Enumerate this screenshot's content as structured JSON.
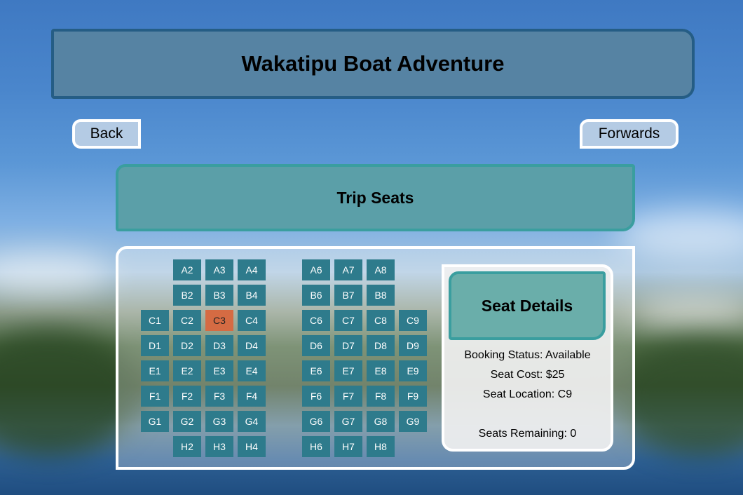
{
  "header": {
    "title": "Wakatipu Boat Adventure"
  },
  "nav": {
    "back_label": "Back",
    "forward_label": "Forwards"
  },
  "trip": {
    "title": "Trip Seats"
  },
  "seats": {
    "selected": "C3",
    "left_block": [
      [
        "",
        "A2",
        "A3",
        "A4"
      ],
      [
        "",
        "B2",
        "B3",
        "B4"
      ],
      [
        "C1",
        "C2",
        "C3",
        "C4"
      ],
      [
        "D1",
        "D2",
        "D3",
        "D4"
      ],
      [
        "E1",
        "E2",
        "E3",
        "E4"
      ],
      [
        "F1",
        "F2",
        "F3",
        "F4"
      ],
      [
        "G1",
        "G2",
        "G3",
        "G4"
      ],
      [
        "",
        "H2",
        "H3",
        "H4"
      ]
    ],
    "right_block": [
      [
        "A6",
        "A7",
        "A8",
        ""
      ],
      [
        "B6",
        "B7",
        "B8",
        ""
      ],
      [
        "C6",
        "C7",
        "C8",
        "C9"
      ],
      [
        "D6",
        "D7",
        "D8",
        "D9"
      ],
      [
        "E6",
        "E7",
        "E8",
        "E9"
      ],
      [
        "F6",
        "F7",
        "F8",
        "F9"
      ],
      [
        "G6",
        "G7",
        "G8",
        "G9"
      ],
      [
        "H6",
        "H7",
        "H8",
        ""
      ]
    ],
    "colors": {
      "available": "#2e7b8c",
      "selected": "#d56b43"
    }
  },
  "details": {
    "title": "Seat Details",
    "booking_status": "Booking Status: Available",
    "seat_cost": "Seat Cost: $25",
    "seat_location": "Seat Location: C9",
    "seats_remaining": "Seats Remaining: 0"
  }
}
